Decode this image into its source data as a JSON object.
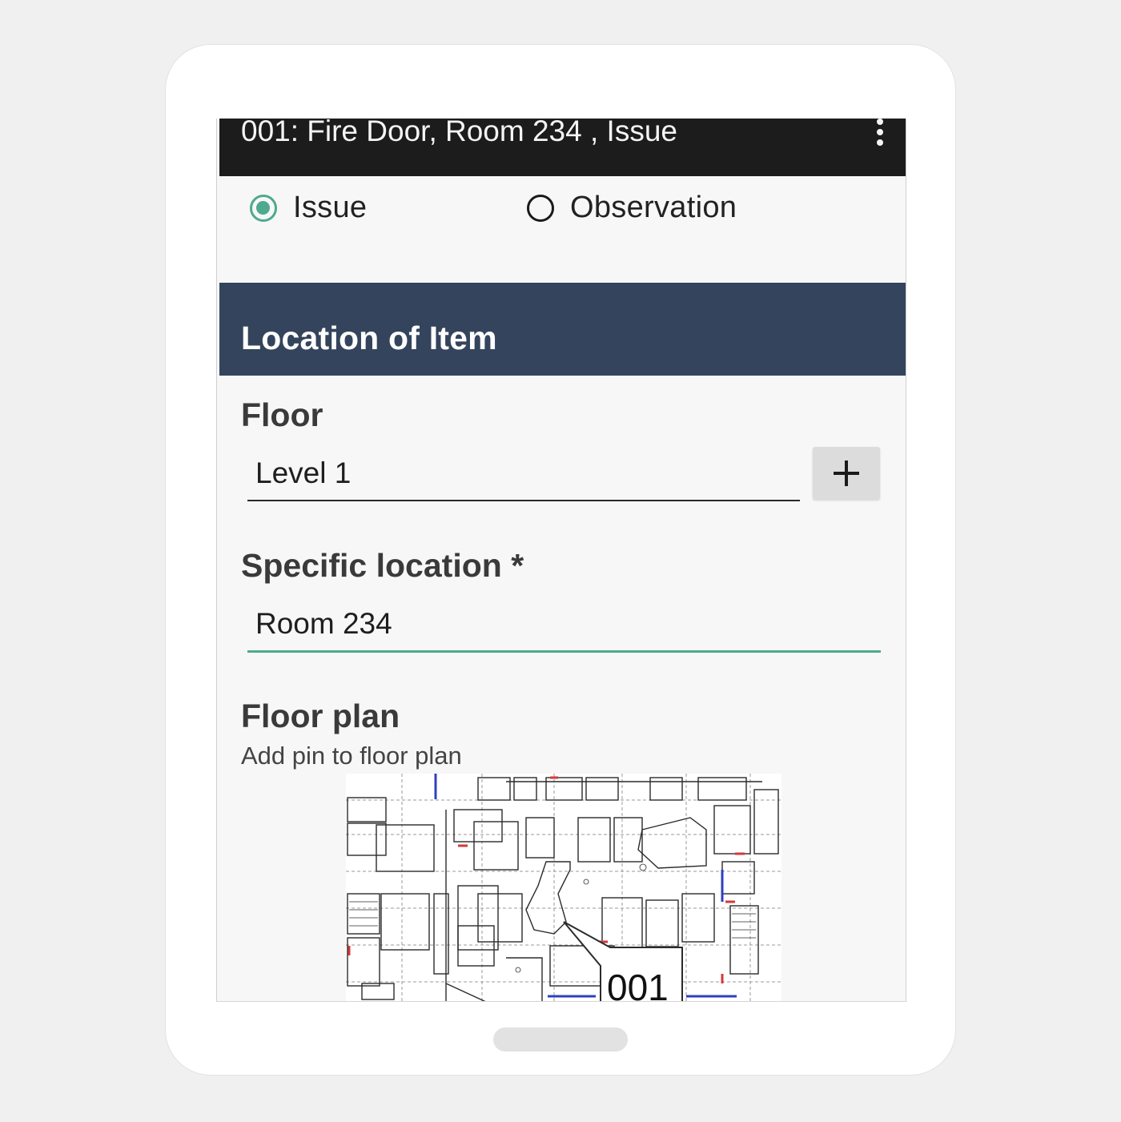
{
  "title_bar": {
    "title": "001: Fire Door, Room 234 , Issue",
    "menu_icon": "kebab-menu-icon"
  },
  "type_options": [
    {
      "label": "Issue",
      "checked": true
    },
    {
      "label": "Observation",
      "checked": false
    }
  ],
  "section": {
    "title": "Location of Item"
  },
  "floor": {
    "label": "Floor",
    "value": "Level 1",
    "add_icon": "plus-icon"
  },
  "specific_location": {
    "label": "Specific location *",
    "value": "Room 234"
  },
  "floor_plan": {
    "label": "Floor plan",
    "hint": "Add pin to floor plan",
    "pin_label": "001"
  },
  "colors": {
    "accent": "#4fa98f",
    "section_bar": "#34445c",
    "title_bar": "#1c1c1c"
  }
}
